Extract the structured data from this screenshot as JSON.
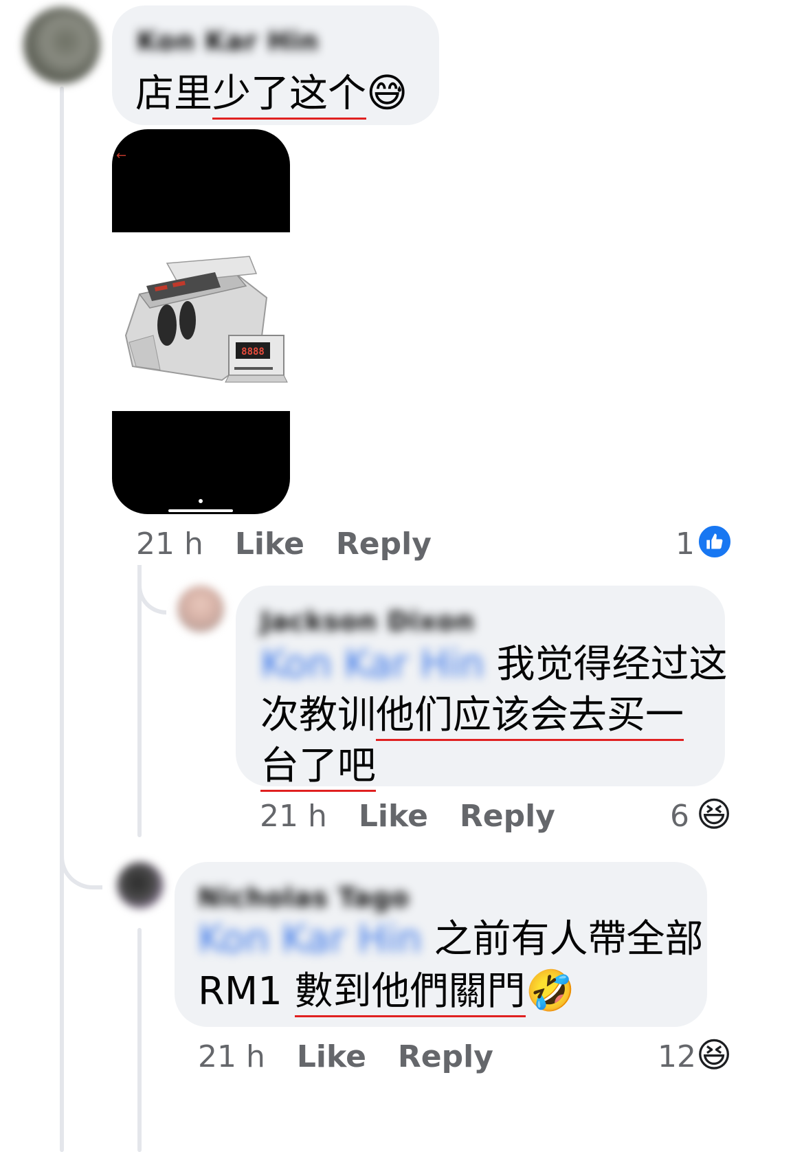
{
  "comments": [
    {
      "author": "Kon Kar Hin",
      "text_plain": "店里",
      "text_underlined": "少了这个",
      "emoji": "😅",
      "time": "21 h",
      "like_label": "Like",
      "reply_label": "Reply",
      "reaction_count": "1",
      "reaction_icon": "like-icon"
    },
    {
      "author": "Jackson Dixon",
      "tag": "Kon Kar Hin",
      "line1": "我觉得经过这",
      "line2_plain": "次教训",
      "line2_underlined": "他们应该会去买一",
      "line3_underlined": "台了吧",
      "time": "21 h",
      "like_label": "Like",
      "reply_label": "Reply",
      "reaction_count": "6",
      "reaction_icon": "haha-icon"
    },
    {
      "author": "Nicholas Tago",
      "tag": "Kon Kar Hin",
      "line1": "之前有人帶全部",
      "line2_plain": "RM1 ",
      "line2_underlined": "數到他們關門",
      "emoji": "🤣",
      "time": "21 h",
      "like_label": "Like",
      "reply_label": "Reply",
      "reaction_count": "12",
      "reaction_icon": "haha-icon"
    }
  ],
  "attachment": {
    "back_arrow": "←",
    "display_digits": "8888"
  },
  "colors": {
    "bubble": "#f0f2f5",
    "meta": "#65676b",
    "tag": "#3a76e8",
    "underline": "#e02020",
    "like_blue": "#1877f2"
  }
}
